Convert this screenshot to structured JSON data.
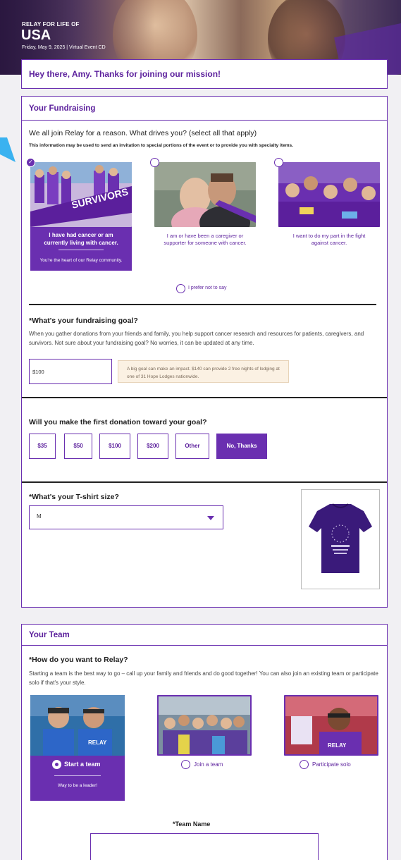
{
  "hero": {
    "label_small": "RELAY FOR LIFE OF",
    "title": "USA",
    "subtitle": "Friday, May 9, 2025 | Virtual Event CD"
  },
  "greeting": "Hey there, Amy. Thanks for joining our mission!",
  "fundraising": {
    "title": "Your Fundraising",
    "question": "We all join Relay for a reason. What drives you? (select all that apply)",
    "note": "This information may be used to send an invitation to special portions of the event or to provide you with specialty items.",
    "options": [
      {
        "label": "I have had cancer or am currently living with cancer.",
        "sublabel": "You're the heart of our Relay community.",
        "selected": true
      },
      {
        "label": "I am or have been a caregiver or supporter for someone with cancer.",
        "selected": false
      },
      {
        "label": "I want to do my part in the fight against cancer.",
        "selected": false
      }
    ],
    "prefer_not": "I prefer not to say",
    "goal_question": "*What's your fundraising goal?",
    "goal_body": "When you gather donations from your friends and family, you help support cancer research and resources for patients, caregivers, and survivors. Not sure about your fundraising goal? No worries, it can be updated at any time.",
    "goal_value": "$100",
    "goal_tip": "A big goal can make an impact. $140 can provide 2 free nights of lodging at one of 31 Hope Lodges nationwide.",
    "donation_question": "Will you make the first donation toward your goal?",
    "donation_options": [
      "$35",
      "$50",
      "$100",
      "$200",
      "Other",
      "No, Thanks"
    ],
    "donation_selected": "No, Thanks",
    "tshirt_question": "*What's your T-shirt size?",
    "tshirt_value": "M"
  },
  "team": {
    "title": "Your Team",
    "question": "*How do you want to Relay?",
    "body": "Starting a team is the best way to go – call up your family and friends and do good together! You can also join an existing team or participate solo if that's your style.",
    "options": [
      {
        "label": "Start a team",
        "sublabel": "Way to be a leader!",
        "selected": true
      },
      {
        "label": "Join a team",
        "selected": false
      },
      {
        "label": "Participate solo",
        "selected": false
      }
    ],
    "team_name_label": "*Team Name"
  },
  "colors": {
    "brand": "#6a2fb0",
    "brand_dark": "#5b1f9c",
    "tip_bg": "#fbf1e3"
  }
}
